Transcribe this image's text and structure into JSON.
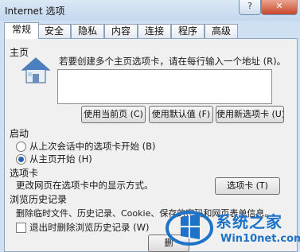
{
  "window": {
    "title": "Internet 选项",
    "help_label": "?",
    "close_label": "✕"
  },
  "tabs": [
    "常规",
    "安全",
    "隐私",
    "内容",
    "连接",
    "程序",
    "高级"
  ],
  "home": {
    "group_label": "主页",
    "instruction": "若要创建多个主页选项卡，请在每行输入一个地址 (R)。",
    "address_value": "",
    "buttons": [
      "使用当前页 (C)",
      "使用默认值 (F)",
      "使用新选项卡 (U)"
    ]
  },
  "startup": {
    "group_label": "启动",
    "options": [
      "从上次会话中的选项卡开始 (B)",
      "从主页开始 (H)"
    ],
    "selected_index": 1
  },
  "tabs_section": {
    "group_label": "选项卡",
    "description": "更改网页在选项卡中的显示方式。",
    "button": "选项卡 (T)"
  },
  "history": {
    "group_label": "浏览历史记录",
    "description": "删除临时文件、历史记录、Cookie、保存的密码和网页表单信息。",
    "checkbox_label": "退出时删除浏览历史记录 (W)",
    "checkbox_checked": false,
    "delete_button": "删"
  },
  "watermark": {
    "brand": "系统之家",
    "url": "Win10net.com"
  },
  "colors": {
    "title_bar": "#c4d8ee",
    "panel": "#f0f0f0",
    "radio_dot": "#2a5fb8",
    "logo_blue": "#1e73c8"
  }
}
